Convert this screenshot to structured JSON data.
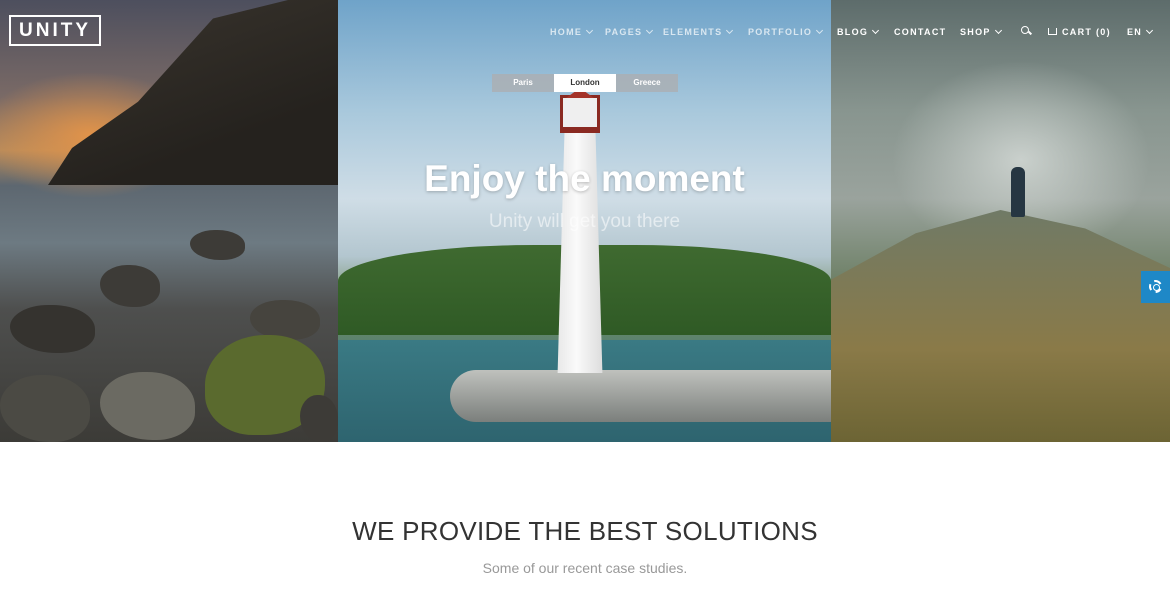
{
  "brand": {
    "logo": "UNITY"
  },
  "nav": {
    "items": [
      {
        "label": "HOME",
        "has_caret": true
      },
      {
        "label": "PAGES",
        "has_caret": true
      },
      {
        "label": "ELEMENTS",
        "has_caret": true
      },
      {
        "label": "PORTFOLIO",
        "has_caret": true
      },
      {
        "label": "BLOG",
        "has_caret": true
      },
      {
        "label": "CONTACT",
        "has_caret": false
      },
      {
        "label": "SHOP",
        "has_caret": true
      }
    ],
    "search_icon": "search-icon",
    "cart_label": "CART (0)",
    "cart_icon": "cart-icon",
    "language": "EN"
  },
  "slider": {
    "tabs": [
      {
        "label": "Paris",
        "active": false
      },
      {
        "label": "London",
        "active": true
      },
      {
        "label": "Greece",
        "active": false
      }
    ],
    "headline": "Enjoy the moment",
    "subheadline": "Unity will get you there"
  },
  "settings": {
    "icon": "gear-icon",
    "color": "#1e88c7"
  },
  "section": {
    "title": "WE PROVIDE THE BEST SOLUTIONS",
    "subtitle": "Some of our recent case studies."
  }
}
